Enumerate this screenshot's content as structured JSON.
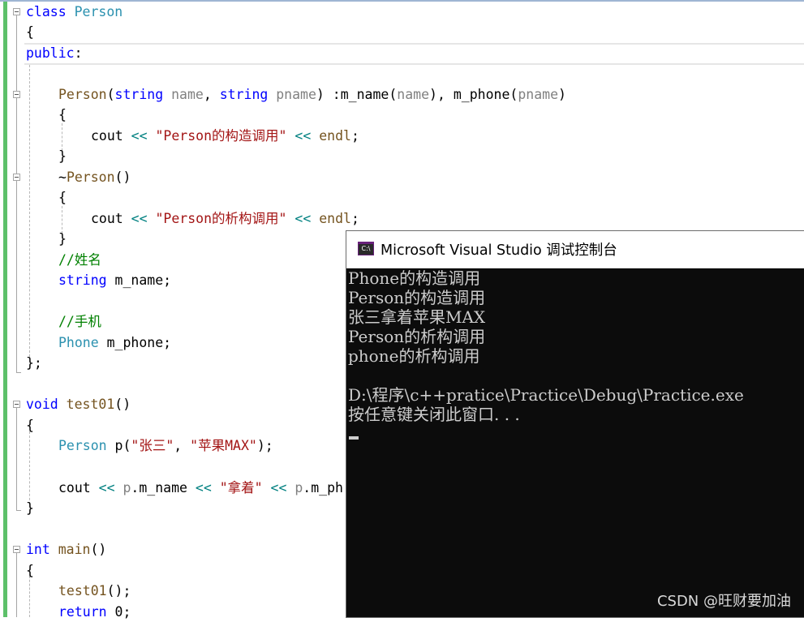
{
  "editor": {
    "lines": {
      "l1": {
        "kw": "class",
        "name": " Person"
      },
      "l2": "{",
      "l3": {
        "kw": "public",
        "colon": ":"
      },
      "l5": {
        "ctor": "Person",
        "p1": "(",
        "t1": "string",
        "n1": " name",
        "c1": ", ",
        "t2": "string",
        "n2": " pname",
        "p2": ")",
        "init": " :m_name",
        "p3": "(",
        "a1": "name",
        "p4": "), ",
        "m2": "m_phone",
        "p5": "(",
        "a2": "pname",
        "p6": ")"
      },
      "l6": "{",
      "l7": {
        "cout": "cout ",
        "op1": "<<",
        "str": " \"Person的构造调用\" ",
        "op2": "<<",
        "endl": " endl",
        "semi": ";"
      },
      "l8": "}",
      "l9": {
        "tilde": "~",
        "dtor": "Person",
        "parens": "()"
      },
      "l10": "{",
      "l11": {
        "cout": "cout ",
        "op1": "<<",
        "str": " \"Person的析构调用\" ",
        "op2": "<<",
        "endl": " endl",
        "semi": ";"
      },
      "l12": "}",
      "l13": "//姓名",
      "l14": {
        "type": "string",
        "rest": " m_name;"
      },
      "l16": "//手机",
      "l17": {
        "type": "Phone",
        "rest": " m_phone;"
      },
      "l18": "};",
      "l20": {
        "kw": "void",
        "name": " test01",
        "parens": "()"
      },
      "l21": "{",
      "l22": {
        "type": "Person",
        "var": " p(",
        "s1": "\"张三\"",
        "c": ", ",
        "s2": "\"苹果MAX\"",
        "end": ");"
      },
      "l24": {
        "cout": "cout ",
        "op1": "<<",
        "var": " p",
        "dot": ".",
        "mem": "m_name ",
        "op2": "<<",
        "str": " \"拿着\" ",
        "op3": "<<",
        "var2": " p",
        "dot2": ".",
        "mem2": "m_ph"
      },
      "l25": "}",
      "l27": {
        "kw": "int",
        "name": " main",
        "parens": "()"
      },
      "l28": "{",
      "l29": {
        "call": "test01",
        "rest": "();"
      },
      "l30": {
        "kw": "return",
        "rest": " 0;"
      }
    }
  },
  "console": {
    "title": "Microsoft Visual Studio 调试控制台",
    "icon_label": "C:\\",
    "output": [
      "Phone的构造调用",
      "Person的构造调用",
      "张三拿着苹果MAX",
      "Person的析构调用",
      "phone的析构调用",
      "",
      "D:\\程序\\c++pratice\\Practice\\Debug\\Practice.exe",
      "按任意键关闭此窗口. . ."
    ]
  },
  "watermark": "CSDN @旺财要加油"
}
